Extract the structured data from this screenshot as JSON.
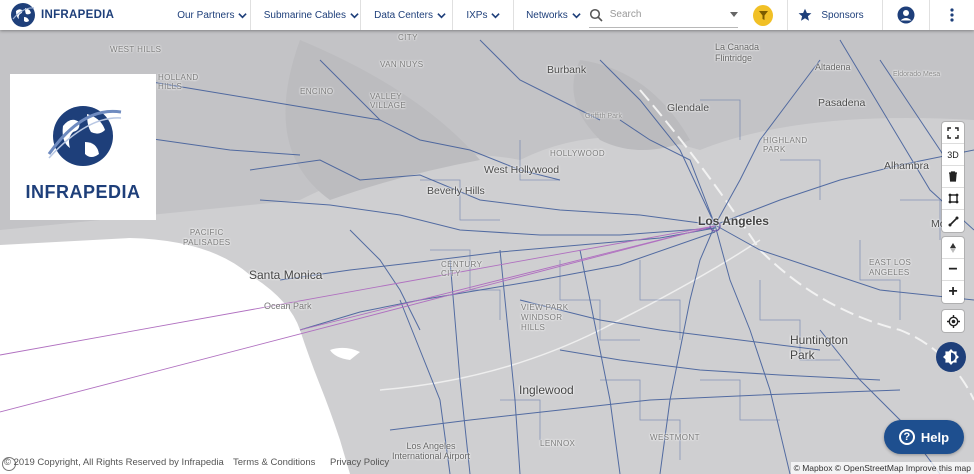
{
  "brand": {
    "name": "INFRAPEDIA"
  },
  "nav": {
    "items": [
      {
        "label": "Our Partners"
      },
      {
        "label": "Submarine Cables"
      },
      {
        "label": "Data Centers"
      },
      {
        "label": "IXPs"
      },
      {
        "label": "Networks"
      }
    ],
    "search_placeholder": "Search",
    "sponsors_label": "Sponsors"
  },
  "logo_panel": {
    "label": "INFRAPEDIA"
  },
  "map": {
    "places": [
      {
        "name": "Burbank"
      },
      {
        "name": "La Canada\nFlintridge"
      },
      {
        "name": "Altadena"
      },
      {
        "name": "Glendale"
      },
      {
        "name": "Pasadena"
      },
      {
        "name": "West Hollywood"
      },
      {
        "name": "Beverly Hills"
      },
      {
        "name": "Alhambra"
      },
      {
        "name": "Los Angeles"
      },
      {
        "name": "Monter"
      },
      {
        "name": "Santa Monica"
      },
      {
        "name": "Ocean Park"
      },
      {
        "name": "Huntington\nPark"
      },
      {
        "name": "Inglewood"
      },
      {
        "name": "Los Angeles\nInternational Airport"
      },
      {
        "name": "WEST HILLS"
      },
      {
        "name": "HOLLAND\nHILLS"
      },
      {
        "name": "PACIFIC\nPALISADES"
      },
      {
        "name": "ENCINO"
      },
      {
        "name": "VAN NUYS"
      },
      {
        "name": "VALLEY\nVILLAGE"
      },
      {
        "name": "Griffith Park"
      },
      {
        "name": "HOLLYWOOD"
      },
      {
        "name": "HIGHLAND\nPARK"
      },
      {
        "name": "EAST LOS\nANGELES"
      },
      {
        "name": "VIEW PARK\nWINDSOR\nHILLS"
      },
      {
        "name": "WESTMONT"
      },
      {
        "name": "LENNOX"
      },
      {
        "name": "Eldorado Mesa"
      },
      {
        "name": "CITY"
      },
      {
        "name": "CENTURY\nCITY"
      }
    ]
  },
  "controls": {
    "top": [
      {
        "label": "fullscreen"
      },
      {
        "label": "3D"
      },
      {
        "label": "trash"
      },
      {
        "label": "polygon"
      },
      {
        "label": "line"
      }
    ],
    "nav": [
      {
        "label": "compass"
      },
      {
        "label": "−"
      },
      {
        "label": "+"
      }
    ],
    "threeD_label": "3D",
    "zoom_out_label": "−",
    "zoom_in_label": "+"
  },
  "help": {
    "label": "Help"
  },
  "footer": {
    "copyright": "© 2019 Copyright, All Rights Reserved by Infrapedia",
    "terms": "Terms & Conditions",
    "privacy": "Privacy Policy"
  },
  "attribution": {
    "text": "© Mapbox © OpenStreetMap Improve this map"
  },
  "colors": {
    "accent": "#1e3f7a",
    "badge": "#f1c026",
    "cable": "#3d5a99",
    "submarine": "#b070c0"
  }
}
